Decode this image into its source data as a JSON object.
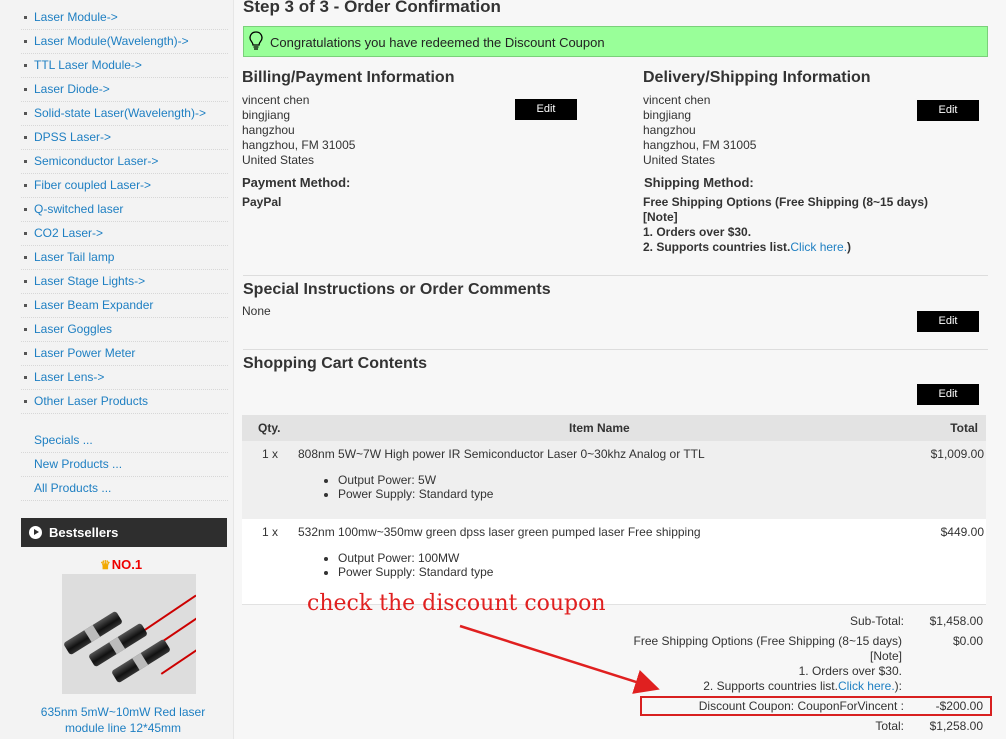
{
  "sidebar": {
    "categories": [
      "Laser Module->",
      "Laser Module(Wavelength)->",
      "TTL Laser Module->",
      "Laser Diode->",
      "Solid-state Laser(Wavelength)->",
      "DPSS Laser->",
      "Semiconductor Laser->",
      "Fiber coupled Laser->",
      "Q-switched laser",
      "CO2 Laser->",
      "Laser Tail lamp",
      "Laser Stage Lights->",
      "Laser Beam Expander",
      "Laser Goggles",
      "Laser Power Meter",
      "Laser Lens->",
      "Other Laser Products"
    ],
    "extra": [
      "Specials ...",
      "New Products ...",
      "All Products ..."
    ],
    "bestsellers_title": "Bestsellers",
    "rank": "NO.1",
    "product_name": "635nm 5mW~10mW Red laser module line 12*45mm"
  },
  "page": {
    "title": "Step 3 of 3 - Order Confirmation",
    "success_message": "Congratulations you have redeemed the Discount Coupon"
  },
  "billing": {
    "heading": "Billing/Payment Information",
    "lines": [
      "vincent chen",
      "bingjiang",
      "hangzhou",
      "hangzhou, FM 31005",
      "United States"
    ],
    "edit": "Edit",
    "payment_heading": "Payment Method:",
    "payment_value": "PayPal"
  },
  "delivery": {
    "heading": "Delivery/Shipping Information",
    "lines": [
      "vincent chen",
      "bingjiang",
      "hangzhou",
      "hangzhou, FM 31005",
      "United States"
    ],
    "edit": "Edit",
    "shipping_heading": "Shipping Method:",
    "shipping_line1": "Free Shipping Options (Free Shipping (8~15 days)",
    "shipping_line2": "[Note]",
    "shipping_line3": "1. Orders over $30.",
    "shipping_line4": "2. Supports countries list.",
    "shipping_link": "Click here.",
    "shipping_close": ")"
  },
  "instructions": {
    "heading": "Special Instructions or Order Comments",
    "value": "None",
    "edit": "Edit"
  },
  "cart": {
    "heading": "Shopping Cart Contents",
    "edit": "Edit",
    "columns": [
      "Qty.",
      "Item Name",
      "Total"
    ],
    "items": [
      {
        "qty": "1 x",
        "name": "808nm 5W~7W High power IR Semiconductor Laser 0~30khz Analog or TTL",
        "attrs": [
          "Output Power: 5W",
          "Power Supply: Standard type"
        ],
        "price": "$1,009.00"
      },
      {
        "qty": "1 x",
        "name": "532nm 100mw~350mw green dpss laser green pumped laser Free shipping",
        "attrs": [
          "Output Power: 100MW",
          "Power Supply: Standard type"
        ],
        "price": "$449.00"
      }
    ]
  },
  "totals": {
    "subtotal_label": "Sub-Total:",
    "subtotal_value": "$1,458.00",
    "shipping_label1": "Free Shipping Options (Free Shipping (8~15 days)",
    "shipping_label2": "[Note]",
    "shipping_label3": "1. Orders over $30.",
    "shipping_label4": "2. Supports countries list.",
    "shipping_link": "Click here.",
    "shipping_close": "):",
    "shipping_value": "$0.00",
    "discount_label": "Discount Coupon: CouponForVincent :",
    "discount_value": "-$200.00",
    "total_label": "Total:",
    "total_value": "$1,258.00"
  },
  "annotation": {
    "text": "check the discount coupon",
    "color": "#e02020"
  }
}
